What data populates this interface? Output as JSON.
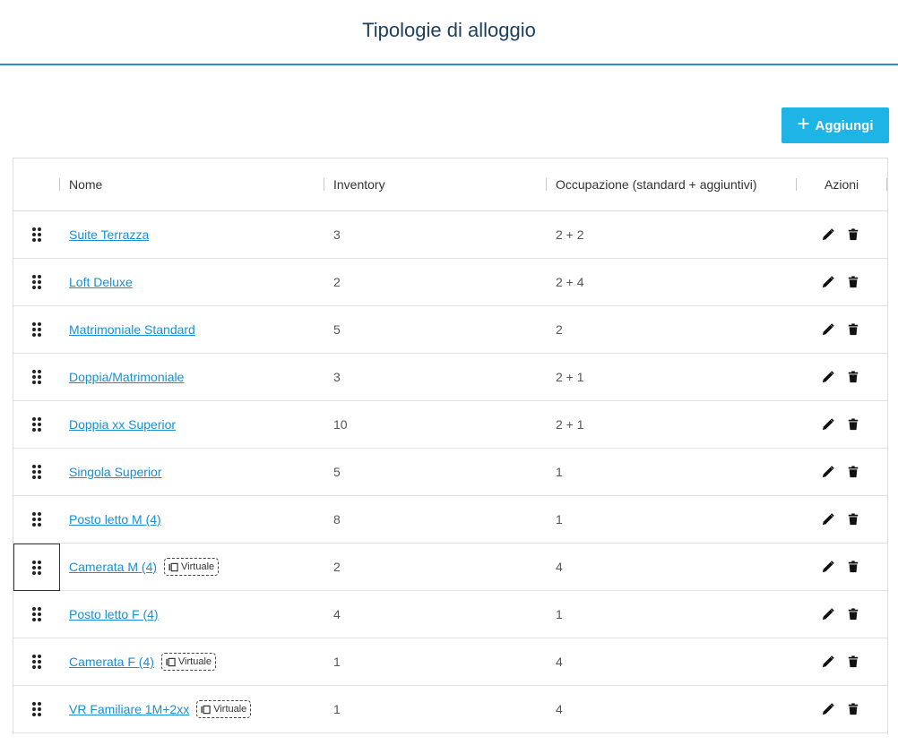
{
  "page": {
    "title": "Tipologie di alloggio"
  },
  "toolbar": {
    "add_label": "Aggiungi"
  },
  "table": {
    "columns": {
      "name": "Nome",
      "inventory": "Inventory",
      "occupancy": "Occupazione (standard + aggiuntivi)",
      "actions": "Azioni"
    },
    "badge_label": "Virtuale",
    "rows": [
      {
        "name": "Suite Terrazza",
        "inventory": "3",
        "occupancy": "2 + 2",
        "virtual": false
      },
      {
        "name": "Loft Deluxe",
        "inventory": "2",
        "occupancy": "2 + 4",
        "virtual": false
      },
      {
        "name": "Matrimoniale Standard",
        "inventory": "5",
        "occupancy": "2",
        "virtual": false
      },
      {
        "name": "Doppia/Matrimoniale",
        "inventory": "3",
        "occupancy": "2 + 1",
        "virtual": false
      },
      {
        "name": "Doppia xx Superior",
        "inventory": "10",
        "occupancy": "2 + 1",
        "virtual": false
      },
      {
        "name": "Singola Superior",
        "inventory": "5",
        "occupancy": "1",
        "virtual": false
      },
      {
        "name": "Posto letto M (4)",
        "inventory": "8",
        "occupancy": "1",
        "virtual": false
      },
      {
        "name": "Camerata M (4)",
        "inventory": "2",
        "occupancy": "4",
        "virtual": true,
        "focused": true
      },
      {
        "name": "Posto letto F (4)",
        "inventory": "4",
        "occupancy": "1",
        "virtual": false
      },
      {
        "name": "Camerata F (4)",
        "inventory": "1",
        "occupancy": "4",
        "virtual": true
      },
      {
        "name": "VR Familiare 1M+2xx",
        "inventory": "1",
        "occupancy": "4",
        "virtual": true
      }
    ]
  },
  "icons": {
    "drag": "drag-handle-icon",
    "edit": "pencil-icon",
    "delete": "trash-icon",
    "virtual": "virtual-room-icon",
    "add": "plus-icon"
  },
  "colors": {
    "accent": "#1eb4e6",
    "link": "#1a8fd1",
    "header_rule": "#2a8ec9",
    "title": "#1d4060"
  }
}
